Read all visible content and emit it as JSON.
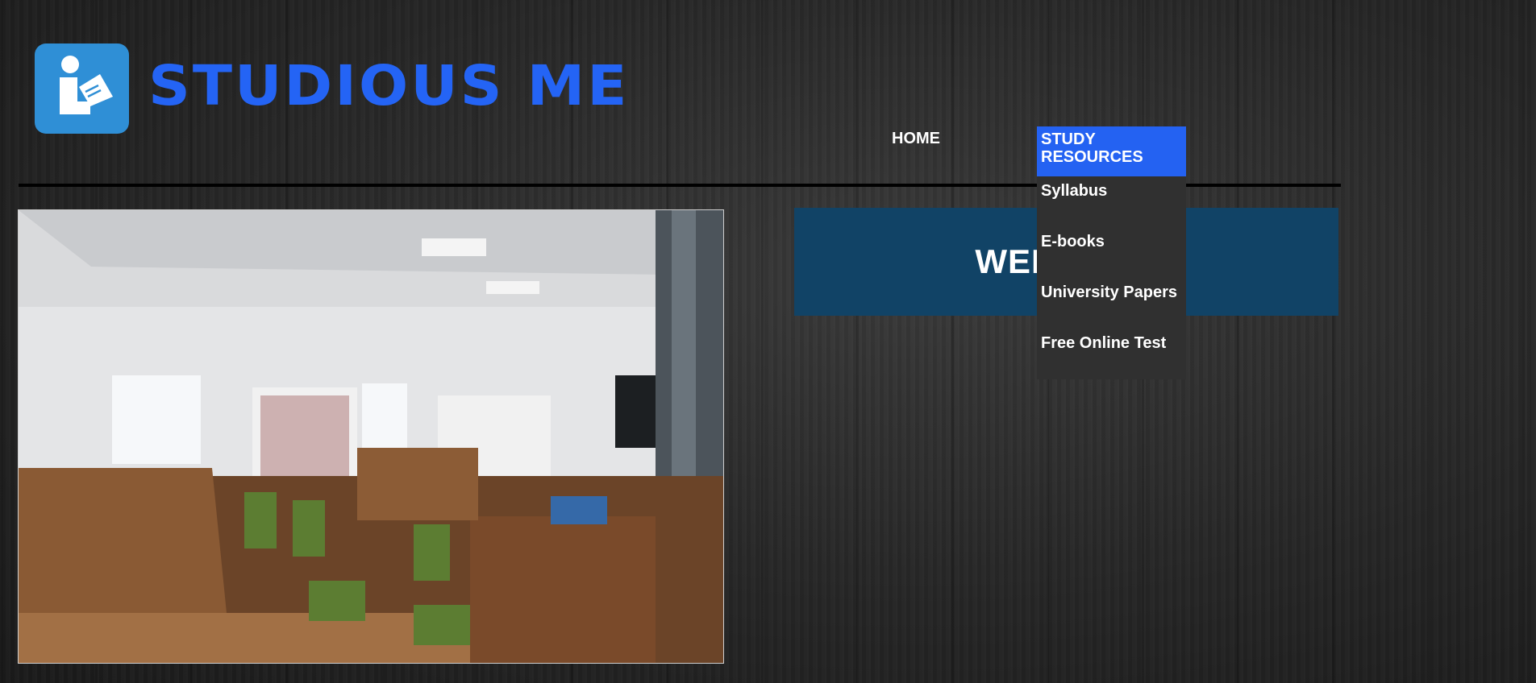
{
  "brand": {
    "name": "STUDIOUS ME",
    "icon": "reader-book-icon",
    "icon_color": "#2f8fd6",
    "text_color": "#2464f5"
  },
  "nav": {
    "home": "HOME",
    "study_resources": {
      "label": "STUDY\nRESOURCES",
      "items": [
        "Syllabus",
        "E-books",
        "University Papers",
        "Free Online Test"
      ]
    }
  },
  "hero": {
    "image": "library-interior-photo"
  },
  "welcome": {
    "title": "WELCOME"
  },
  "colors": {
    "accent": "#2462f2",
    "welcome_bg": "#114366",
    "dropdown_bg": "#303030"
  }
}
